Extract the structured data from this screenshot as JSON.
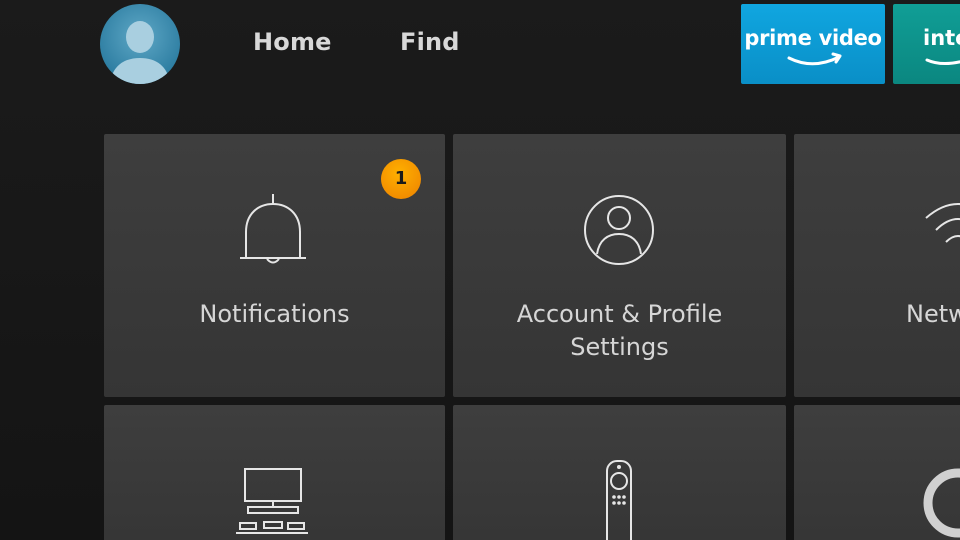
{
  "header": {
    "nav": [
      {
        "label": "Home"
      },
      {
        "label": "Find"
      }
    ],
    "apps": [
      {
        "label": "prime video",
        "color": "#0f9fd9"
      },
      {
        "label": "inte",
        "color": "#0e968e"
      }
    ]
  },
  "settings": {
    "cards": [
      {
        "label": "Notifications",
        "icon": "bell-icon",
        "badge": "1"
      },
      {
        "label_line1": "Account & Profile",
        "label_line2": "Settings",
        "icon": "account-icon"
      },
      {
        "label": "Netw",
        "icon": "wifi-icon"
      },
      {
        "label": "",
        "icon": "display-sounds-icon"
      },
      {
        "label": "",
        "icon": "remote-icon"
      },
      {
        "label": "",
        "icon": "alexa-icon"
      }
    ]
  },
  "colors": {
    "background": "#161616",
    "card": "#3a3a3a",
    "badge": "#f59a00",
    "avatar": "#3a8db1"
  }
}
